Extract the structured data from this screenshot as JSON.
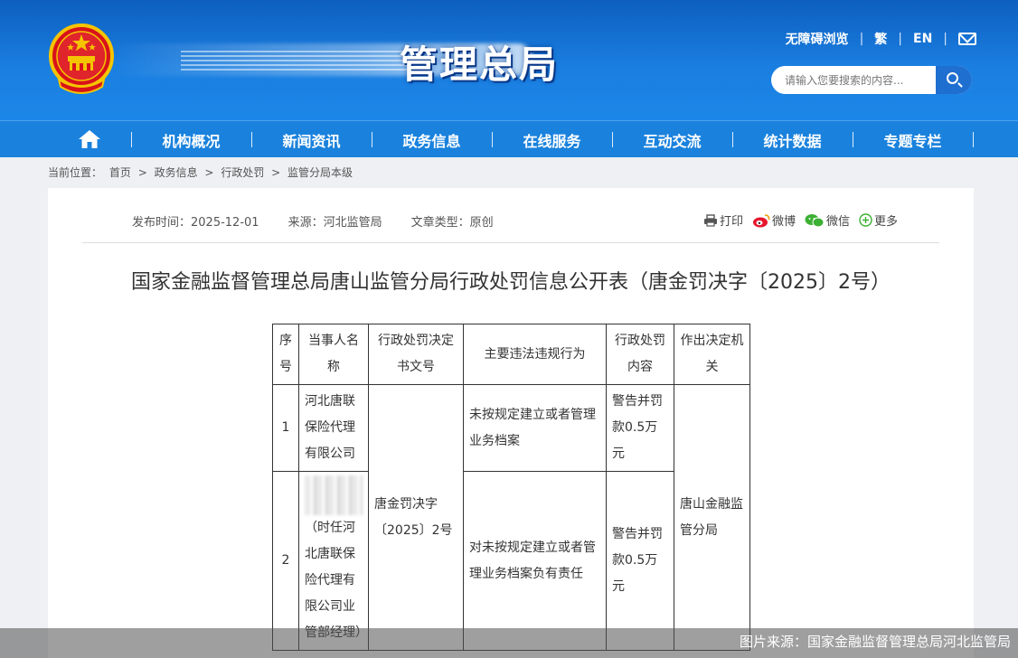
{
  "header": {
    "site_title": "管理总局",
    "accessibility_link": "无障碍浏览",
    "traditional_link": "繁",
    "english_link": "EN",
    "mail_icon": "mail-icon",
    "search": {
      "placeholder": "请输入您要搜索的内容...",
      "icon": "search-icon"
    }
  },
  "nav": {
    "home_icon": "home-icon",
    "items": [
      "机构概况",
      "新闻资讯",
      "政务信息",
      "在线服务",
      "互动交流",
      "统计数据",
      "专题专栏"
    ]
  },
  "breadcrumb": {
    "label": "当前位置：",
    "items": [
      "首页",
      "政务信息",
      "行政处罚",
      "监管分局本级"
    ],
    "separator": ">"
  },
  "article": {
    "publish_time": "发布时间：2025-12-01",
    "source": "来源：河北监管局",
    "type": "文章类型：原创",
    "share": {
      "print": "打印",
      "weibo": "微博",
      "wechat": "微信",
      "more": "更多"
    },
    "title": "国家金融监督管理总局唐山监管分局行政处罚信息公开表（唐金罚决字〔2025〕2号）"
  },
  "table": {
    "headers": [
      "序号",
      "当事人名称",
      "行政处罚决定书文号",
      "主要违法违规行为",
      "行政处罚内容",
      "作出决定机关"
    ],
    "rows": [
      {
        "no": "1",
        "party": "河北唐联保险代理有限公司",
        "violation": "未按规定建立或者管理业务档案",
        "penalty": "警告并罚款0.5万元"
      },
      {
        "no": "2",
        "party": "（时任河北唐联保险代理有限公司业管部经理）",
        "violation": "对未按规定建立或者管理业务档案负有责任",
        "penalty": "警告并罚款0.5万元"
      }
    ],
    "decision_no": "唐金罚决字〔2025〕2号",
    "authority": "唐山金融监管分局"
  },
  "caption": "图片来源：国家金融监督管理总局河北监管局",
  "colors": {
    "header_blue": "#1a7ee0",
    "nav_blue": "#1a82dd",
    "search_button": "#1f6fd1",
    "emblem_red": "#d8121b",
    "emblem_gold": "#f5c400"
  }
}
